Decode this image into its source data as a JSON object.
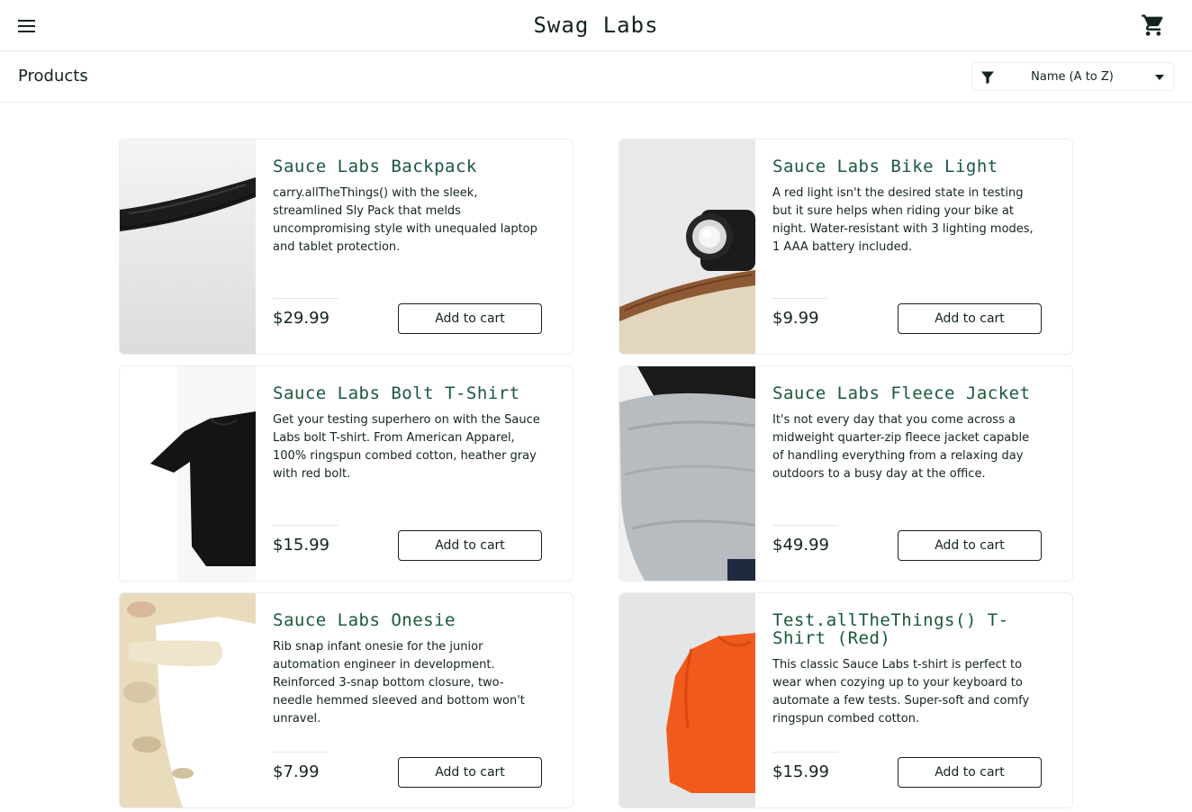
{
  "header": {
    "logo": "Swag Labs",
    "menu_icon": "menu-icon",
    "cart_icon": "shopping-cart-icon"
  },
  "secondary": {
    "title": "Products",
    "sort": {
      "selected": "Name (A to Z)",
      "icon": "filter-icon"
    }
  },
  "colors": {
    "title_green": "#18583a",
    "text_dark": "#132322",
    "border": "#ededed"
  },
  "products": [
    {
      "name": "Sauce Labs Backpack",
      "description": "carry.allTheThings() with the sleek, streamlined Sly Pack that melds uncompromising style with unequaled laptop and tablet protection.",
      "price": "$29.99",
      "button": "Add to cart",
      "image": "backpack-image"
    },
    {
      "name": "Sauce Labs Bike Light",
      "description": "A red light isn't the desired state in testing but it sure helps when riding your bike at night. Water-resistant with 3 lighting modes, 1 AAA battery included.",
      "price": "$9.99",
      "button": "Add to cart",
      "image": "bike-light-image"
    },
    {
      "name": "Sauce Labs Bolt T-Shirt",
      "description": "Get your testing superhero on with the Sauce Labs bolt T-shirt. From American Apparel, 100% ringspun combed cotton, heather gray with red bolt.",
      "price": "$15.99",
      "button": "Add to cart",
      "image": "bolt-tshirt-image"
    },
    {
      "name": "Sauce Labs Fleece Jacket",
      "description": "It's not every day that you come across a midweight quarter-zip fleece jacket capable of handling everything from a relaxing day outdoors to a busy day at the office.",
      "price": "$49.99",
      "button": "Add to cart",
      "image": "fleece-jacket-image"
    },
    {
      "name": "Sauce Labs Onesie",
      "description": "Rib snap infant onesie for the junior automation engineer in development. Reinforced 3-snap bottom closure, two-needle hemmed sleeved and bottom won't unravel.",
      "price": "$7.99",
      "button": "Add to cart",
      "image": "onesie-image"
    },
    {
      "name": "Test.allTheThings() T-Shirt (Red)",
      "description": "This classic Sauce Labs t-shirt is perfect to wear when cozying up to your keyboard to automate a few tests. Super-soft and comfy ringspun combed cotton.",
      "price": "$15.99",
      "button": "Add to cart",
      "image": "red-tshirt-image"
    }
  ]
}
